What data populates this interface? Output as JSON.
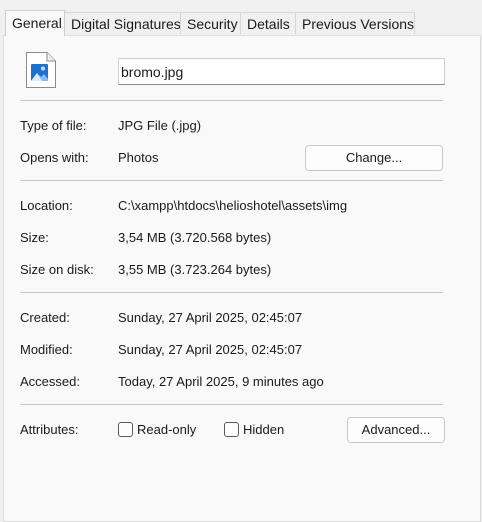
{
  "tabs": [
    {
      "label": "General",
      "active": true
    },
    {
      "label": "Digital Signatures",
      "active": false
    },
    {
      "label": "Security",
      "active": false
    },
    {
      "label": "Details",
      "active": false
    },
    {
      "label": "Previous Versions",
      "active": false
    }
  ],
  "file": {
    "icon": "image-file-icon",
    "name": "bromo.jpg"
  },
  "type_section": {
    "type_label": "Type of file:",
    "type_value": "JPG File (.jpg)",
    "opens_label": "Opens with:",
    "opens_value": "Photos",
    "change_button": "Change..."
  },
  "location_section": {
    "location_label": "Location:",
    "location_value": "C:\\xampp\\htdocs\\helioshotel\\assets\\img",
    "size_label": "Size:",
    "size_value": "3,54 MB (3.720.568 bytes)",
    "size_on_disk_label": "Size on disk:",
    "size_on_disk_value": "3,55 MB (3.723.264 bytes)"
  },
  "dates_section": {
    "created_label": "Created:",
    "created_value": "Sunday, 27 April 2025, 02:45:07",
    "modified_label": "Modified:",
    "modified_value": "Sunday, 27 April 2025, 02:45:07",
    "accessed_label": "Accessed:",
    "accessed_value": "Today, 27 April 2025, 9 minutes ago"
  },
  "attributes_section": {
    "label": "Attributes:",
    "readonly_label": "Read-only",
    "readonly_checked": false,
    "hidden_label": "Hidden",
    "hidden_checked": false,
    "advanced_button": "Advanced..."
  },
  "colors": {
    "window_bg": "#f0f0f0",
    "panel_bg": "#f9f9f9",
    "icon_blue": "#1f6fd1"
  }
}
